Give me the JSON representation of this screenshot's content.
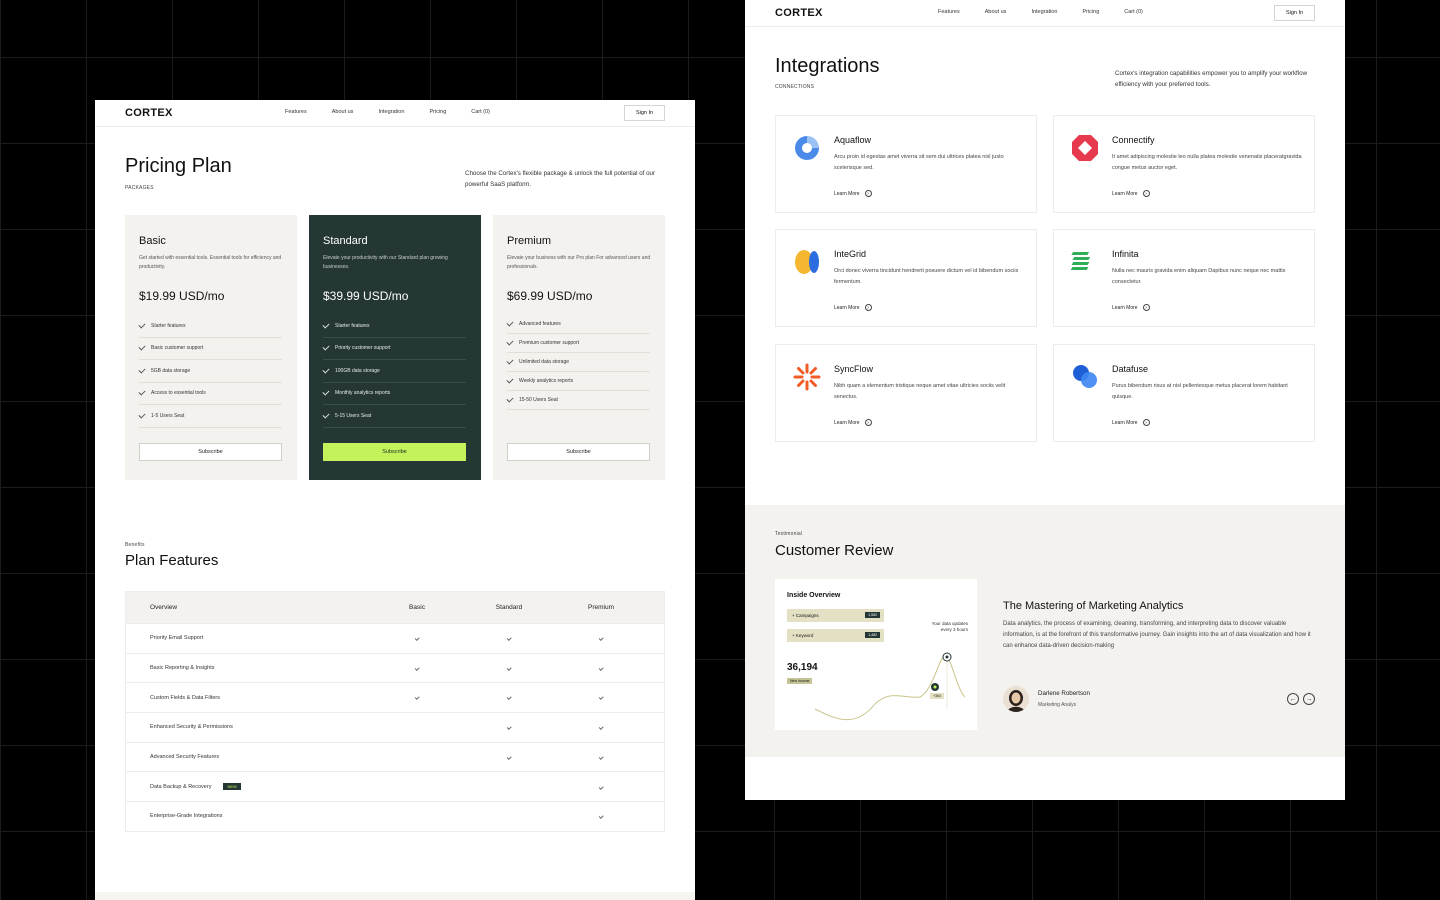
{
  "nav": {
    "logo": "CORTEX",
    "links": [
      "Features",
      "About us",
      "Integration",
      "Pricing",
      "Cart (0)"
    ],
    "signin": "Sign In"
  },
  "pricing": {
    "title": "Pricing Plan",
    "eyebrow": "PACKAGES",
    "intro": "Choose the Cortex's flexible package & unlock the full potential of our powerful SaaS platform.",
    "plans": [
      {
        "name": "Basic",
        "desc": "Get started with essential tools. Essential tools for efficiency and productivity.",
        "price": "$19.99 USD/mo",
        "features": [
          "Starter features",
          "Basic customer support",
          "5GB data storage",
          "Access to essential tools",
          "1-5 Users Seat"
        ],
        "cta": "Subscribe"
      },
      {
        "name": "Standard",
        "desc": "Elevate your productivity with our Standard plan growing businesses.",
        "price": "$39.99 USD/mo",
        "features": [
          "Starter features",
          "Priority customer support",
          "100GB data storage",
          "Monthly analytics reports",
          "5-15 Users Seat"
        ],
        "cta": "Subscribe"
      },
      {
        "name": "Premium",
        "desc": "Elevate your business with our Pro plan For advanced users and professionals.",
        "price": "$69.99 USD/mo",
        "features": [
          "Advanced features",
          "Premium customer support",
          "Unlimited data storage",
          "Weekly analytics reports",
          "15-50 Users Seat"
        ],
        "cta": "Subscribe"
      }
    ]
  },
  "features": {
    "eyebrow": "Benefits",
    "title": "Plan Features",
    "columns": [
      "Overview",
      "Basic",
      "Standard",
      "Premium"
    ],
    "rows": [
      {
        "label": "Priority Email Support",
        "basic": true,
        "standard": true,
        "premium": true
      },
      {
        "label": "Basic Reporting & Insights",
        "basic": true,
        "standard": true,
        "premium": true
      },
      {
        "label": "Custom Fields & Data Filters",
        "basic": true,
        "standard": true,
        "premium": true
      },
      {
        "label": "Enhanced Security & Permissions",
        "basic": false,
        "standard": true,
        "premium": true
      },
      {
        "label": "Advanced Security Features",
        "basic": false,
        "standard": true,
        "premium": true
      },
      {
        "label": "Data Backup & Recovery",
        "badge": "NEW",
        "basic": false,
        "standard": false,
        "premium": true
      },
      {
        "label": "Enterprise-Grade Integrations",
        "basic": false,
        "standard": false,
        "premium": true
      }
    ]
  },
  "integrations": {
    "title": "Integrations",
    "eyebrow": "CONNECTIONS",
    "intro": "Cortex's integration capabilities empower you to amplify your workflow efficiency with your preferred tools.",
    "link_label": "Learn More",
    "items": [
      {
        "name": "Aquaflow",
        "desc": "Arcu proin id egestas amet viverra sit sem dui ultrices platea nisl justo scelerisque sed."
      },
      {
        "name": "Connectify",
        "desc": "It amet adipiscing molestie leo nulla platea molestie venenatis placeratgravida congue metus auctor eget."
      },
      {
        "name": "InteGrid",
        "desc": "Orci donec viverra tincidunt hendrerit posuere dictum vel id bibendum sociis fermentum."
      },
      {
        "name": "Infinita",
        "desc": "Nulla nec mauris gravida enim aliquam Dapibus nunc neque nec mattis consectetur."
      },
      {
        "name": "SyncFlow",
        "desc": "Nibh quam a elementum tristique neque amet vitae ultricies sociis velit senectus."
      },
      {
        "name": "Datafuse",
        "desc": "Purus bibendum risus at nisl pellentesque metus placerat lorem habitant quisque."
      }
    ]
  },
  "testimonial": {
    "eyebrow": "Testimonial",
    "title": "Customer Review",
    "card": {
      "title": "Inside Overview",
      "pills": [
        {
          "label": "+ Campaigns",
          "count": "1,552"
        },
        {
          "label": "+ Keyword",
          "count": "1,482"
        }
      ],
      "note_line1": "Your data updates",
      "note_line2": "every 3 hours",
      "big_number": "36,194",
      "tag": "New Income",
      "dot_tag": "+364"
    },
    "headline": "The Mastering of Marketing Analytics",
    "body": "Data analytics, the process of examining, cleaning, transforming, and interpreting data to discover valuable information, is at the forefront of this transformative journey. Gain insights into the art of data visualization and how it can enhance data-driven decision-making",
    "author": "Darlene Robertson",
    "role": "Marketing Analys",
    "prev": "←",
    "next": "→"
  },
  "colors": {
    "dark_green": "#253734",
    "lime": "#c4f25b",
    "beige": "#f3f2ee"
  }
}
